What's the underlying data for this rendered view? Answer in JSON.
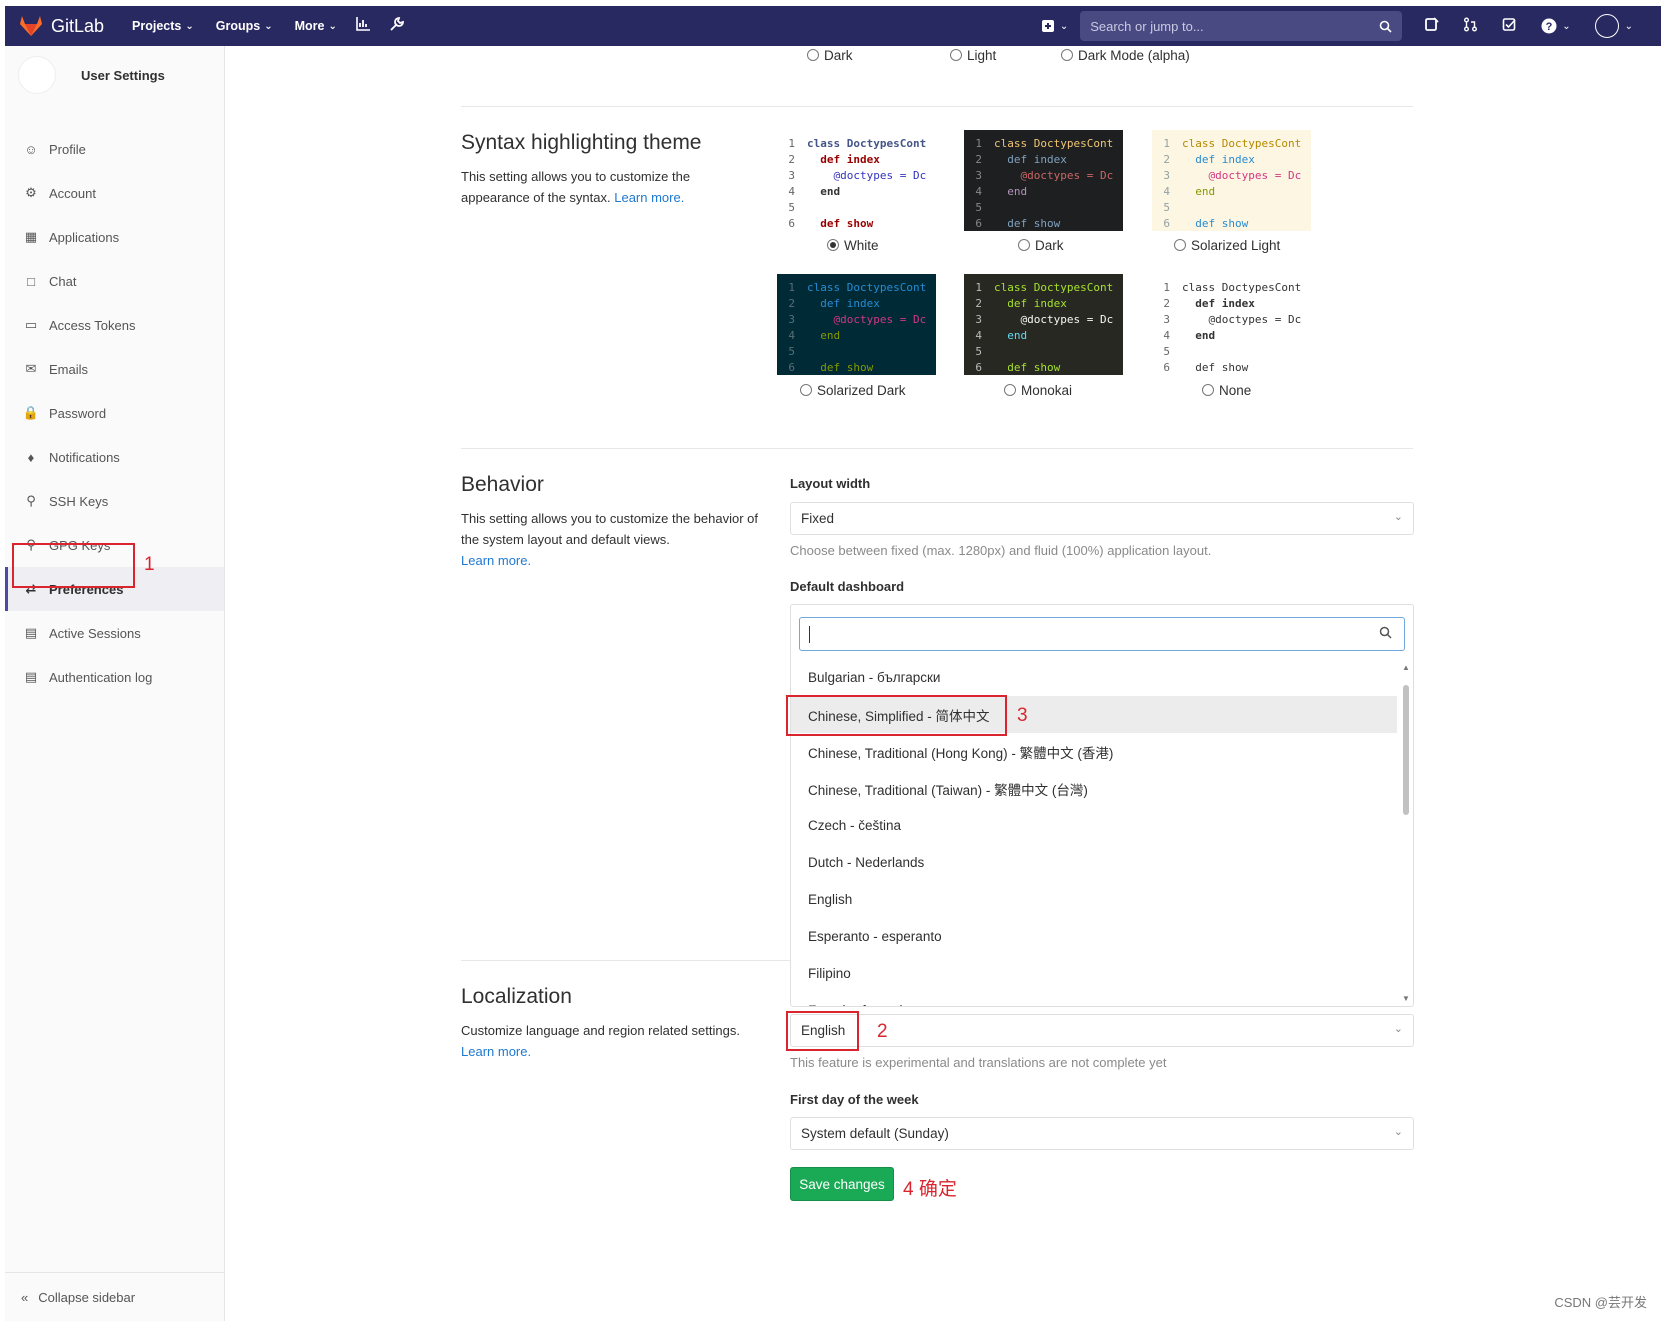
{
  "navbar": {
    "brand": "GitLab",
    "links": [
      "Projects",
      "Groups",
      "More"
    ],
    "search_placeholder": "Search or jump to...",
    "icons": [
      "gitlab-logo-icon",
      "chart-icon",
      "wrench-icon",
      "plus-square-icon",
      "issues-icon",
      "merge-request-icon",
      "todo-icon",
      "help-icon",
      "user-avatar-icon"
    ],
    "colors": {
      "background": "#292961",
      "search_bg": "#4a4a82"
    }
  },
  "sidebar": {
    "title": "User Settings",
    "items": [
      {
        "label": "Profile",
        "icon": "profile-icon"
      },
      {
        "label": "Account",
        "icon": "account-icon"
      },
      {
        "label": "Applications",
        "icon": "applications-icon"
      },
      {
        "label": "Chat",
        "icon": "chat-icon"
      },
      {
        "label": "Access Tokens",
        "icon": "token-icon"
      },
      {
        "label": "Emails",
        "icon": "email-icon"
      },
      {
        "label": "Password",
        "icon": "lock-icon"
      },
      {
        "label": "Notifications",
        "icon": "bell-icon"
      },
      {
        "label": "SSH Keys",
        "icon": "key-icon"
      },
      {
        "label": "GPG Keys",
        "icon": "key-icon"
      },
      {
        "label": "Preferences",
        "icon": "preferences-icon",
        "active": true
      },
      {
        "label": "Active Sessions",
        "icon": "monitor-icon"
      },
      {
        "label": "Authentication log",
        "icon": "log-icon"
      }
    ],
    "collapse_label": "Collapse sidebar"
  },
  "theme_modes": [
    "Dark",
    "Light",
    "Dark Mode (alpha)"
  ],
  "syntax": {
    "title": "Syntax highlighting theme",
    "description": "This setting allows you to customize the appearance of the syntax.",
    "learn_more": "Learn more.",
    "code_lines": [
      "class DoctypesCont",
      "  def index",
      "    @doctypes = Dc",
      "  end",
      "",
      "  def show"
    ],
    "themes": [
      {
        "label": "White",
        "selected": true
      },
      {
        "label": "Dark",
        "selected": false
      },
      {
        "label": "Solarized Light",
        "selected": false
      },
      {
        "label": "Solarized Dark",
        "selected": false
      },
      {
        "label": "Monokai",
        "selected": false
      },
      {
        "label": "None",
        "selected": false
      }
    ]
  },
  "behavior": {
    "title": "Behavior",
    "description": "This setting allows you to customize the behavior of the system layout and default views.",
    "learn_more": "Learn more.",
    "layout_label": "Layout width",
    "layout_value": "Fixed",
    "layout_help": "Choose between fixed (max. 1280px) and fluid (100%) application layout.",
    "dashboard_label": "Default dashboard"
  },
  "language_dropdown": {
    "options": [
      "Bulgarian - български",
      "Chinese, Simplified - 简体中文",
      "Chinese, Traditional (Hong Kong) - 繁體中文 (香港)",
      "Chinese, Traditional (Taiwan) - 繁體中文 (台灣)",
      "Czech - čeština",
      "Dutch - Nederlands",
      "English",
      "Esperanto - esperanto",
      "Filipino",
      "French - français"
    ],
    "highlighted_index": 1
  },
  "localization": {
    "title": "Localization",
    "description": "Customize language and region related settings.",
    "learn_more": "Learn more.",
    "language_value": "English",
    "language_help": "This feature is experimental and translations are not complete yet",
    "week_label": "First day of the week",
    "week_value": "System default (Sunday)"
  },
  "save_label": "Save changes",
  "annotations": {
    "n1": "1",
    "n2": "2",
    "n3": "3",
    "n4": "4 确定",
    "color": "#d9262e"
  },
  "watermark": "CSDN @芸开发"
}
